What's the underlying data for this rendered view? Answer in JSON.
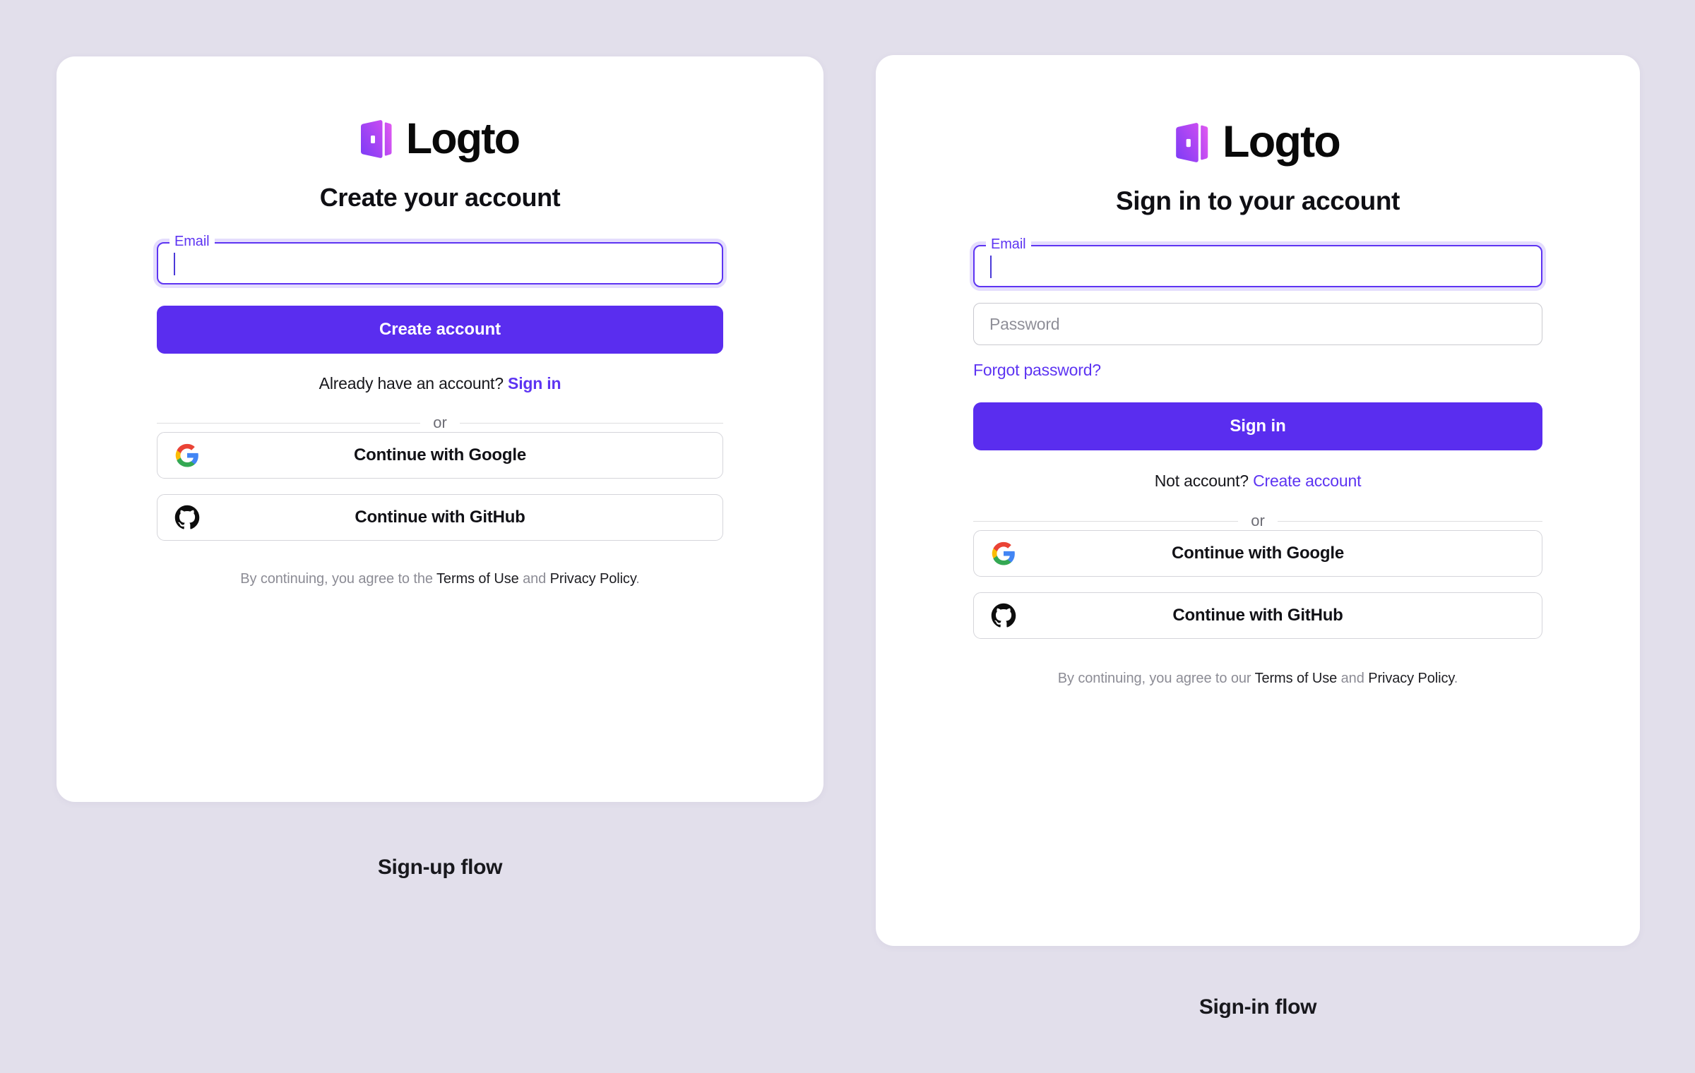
{
  "page": {
    "background_color": "#e2dfeb",
    "accent_color": "#5a2def",
    "link_color": "#5d34f2"
  },
  "brand": {
    "name": "Logto",
    "mark_icon": "logto-door-icon",
    "gradient_from": "#7f3df5",
    "gradient_to": "#d24cf0"
  },
  "signup": {
    "caption": "Sign-up flow",
    "heading": "Create your account",
    "email_field": {
      "label": "Email",
      "value": "",
      "placeholder": "",
      "focused": true
    },
    "primary_button": "Create account",
    "switch": {
      "prefix": "Already have an account?",
      "link": "Sign in"
    },
    "divider_text": "or",
    "social_buttons": [
      {
        "label": "Continue with Google",
        "icon": "google-icon"
      },
      {
        "label": "Continue with GitHub",
        "icon": "github-icon"
      }
    ],
    "terms": {
      "prefix": "By continuing, you agree to the",
      "terms_link": "Terms of Use",
      "middle": "and",
      "privacy_link": "Privacy Policy",
      "suffix": "."
    }
  },
  "signin": {
    "caption": "Sign-in flow",
    "heading": "Sign in to your account",
    "email_field": {
      "label": "Email",
      "value": "",
      "placeholder": "",
      "focused": true
    },
    "password_field": {
      "label": "Password",
      "value": "",
      "placeholder": "Password",
      "focused": false
    },
    "forgot_password": "Forgot password?",
    "primary_button": "Sign in",
    "switch": {
      "prefix": "Not account?",
      "link": "Create account"
    },
    "divider_text": "or",
    "social_buttons": [
      {
        "label": "Continue with Google",
        "icon": "google-icon"
      },
      {
        "label": "Continue with GitHub",
        "icon": "github-icon"
      }
    ],
    "terms": {
      "prefix": "By continuing, you agree to our",
      "terms_link": "Terms of Use",
      "middle": "and",
      "privacy_link": "Privacy Policy",
      "suffix": "."
    }
  }
}
